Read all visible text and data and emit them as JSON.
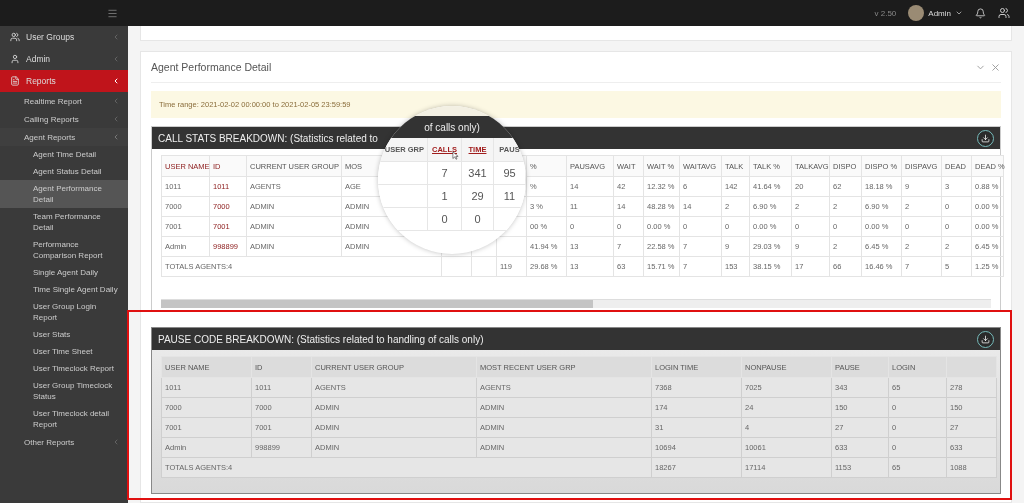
{
  "topbar": {
    "version": "v 2.50",
    "user": "Admin"
  },
  "sidebar": {
    "items": [
      {
        "label": "User Groups",
        "selected": false,
        "expanded": false
      },
      {
        "label": "Admin",
        "selected": false,
        "expanded": false
      },
      {
        "label": "Reports",
        "selected": true,
        "expanded": true,
        "children": [
          {
            "label": "Realtime Report",
            "selected": false,
            "expanded": false
          },
          {
            "label": "Calling Reports",
            "selected": false,
            "expanded": false
          },
          {
            "label": "Agent Reports",
            "selected": false,
            "expanded": true,
            "children": [
              {
                "label": "Agent Time Detail",
                "selected": false
              },
              {
                "label": "Agent Status Detail",
                "selected": false
              },
              {
                "label": "Agent Performance Detail",
                "selected": true
              },
              {
                "label": "Team Performance Detail",
                "selected": false
              },
              {
                "label": "Performance Comparison Report",
                "selected": false
              },
              {
                "label": "Single Agent Daily",
                "selected": false
              },
              {
                "label": "Time Single Agent Daily",
                "selected": false
              },
              {
                "label": "User Group Login Report",
                "selected": false
              },
              {
                "label": "User Stats",
                "selected": false
              },
              {
                "label": "User Time Sheet",
                "selected": false
              },
              {
                "label": "User Timeclock Report",
                "selected": false
              },
              {
                "label": "User Group Timeclock Status",
                "selected": false
              },
              {
                "label": "User Timeclock detail Report",
                "selected": false
              }
            ]
          },
          {
            "label": "Other Reports",
            "selected": false,
            "expanded": false
          }
        ]
      }
    ]
  },
  "panel": {
    "title": "Agent Performance Detail",
    "time_range": "Time range: 2021-02-02 00:00:00 to 2021-02-05 23:59:59"
  },
  "call_stats": {
    "title": "CALL STATS BREAKDOWN: (Statistics related to",
    "columns": [
      {
        "label": "USER NAME",
        "linked": true
      },
      {
        "label": "ID",
        "linked": true
      },
      {
        "label": "CURRENT USER GROUP",
        "linked": false
      },
      {
        "label": "MOS",
        "linked": false
      },
      {},
      {},
      {},
      {
        "label": "%",
        "linked": false
      },
      {
        "label": "PAUSAVG",
        "linked": false
      },
      {
        "label": "WAIT",
        "linked": false
      },
      {
        "label": "WAIT %",
        "linked": false
      },
      {
        "label": "WAITAVG",
        "linked": false
      },
      {
        "label": "TALK",
        "linked": false
      },
      {
        "label": "TALK %",
        "linked": false
      },
      {
        "label": "TALKAVG",
        "linked": false
      },
      {
        "label": "DISPO",
        "linked": false
      },
      {
        "label": "DISPO %",
        "linked": false
      },
      {
        "label": "DISPAVG",
        "linked": false
      },
      {
        "label": "DEAD",
        "linked": false
      },
      {
        "label": "DEAD %",
        "linked": false
      }
    ],
    "rows": [
      [
        "1011",
        "1011",
        "AGENTS",
        "AGE",
        null,
        null,
        null,
        "%",
        "14",
        "42",
        "12.32 %",
        "6",
        "142",
        "41.64 %",
        "20",
        "62",
        "18.18 %",
        "9",
        "3",
        "0.88 %"
      ],
      [
        "7000",
        "7000",
        "ADMIN",
        "ADMIN",
        null,
        null,
        null,
        "3 %",
        "11",
        "14",
        "48.28 %",
        "14",
        "2",
        "6.90 %",
        "2",
        "2",
        "6.90 %",
        "2",
        "0",
        "0.00 %"
      ],
      [
        "7001",
        "7001",
        "ADMIN",
        "ADMIN",
        null,
        null,
        null,
        "00 %",
        "0",
        "0",
        "0.00 %",
        "0",
        "0",
        "0.00 %",
        "0",
        "0",
        "0.00 %",
        "0",
        "0",
        "0.00 %"
      ],
      [
        "Admin",
        "998899",
        "ADMIN",
        "ADMIN",
        null,
        null,
        null,
        "41.94 %",
        "13",
        "7",
        "22.58 %",
        "7",
        "9",
        "29.03 %",
        "9",
        "2",
        "6.45 %",
        "2",
        "2",
        "6.45 %"
      ]
    ],
    "totals": {
      "label": "TOTALS AGENTS:4",
      "cells": [
        null,
        null,
        "119",
        "29.68 %",
        "13",
        "63",
        "15.71 %",
        "7",
        "153",
        "38.15 %",
        "17",
        "66",
        "16.46 %",
        "7",
        "5",
        "1.25 %"
      ]
    }
  },
  "magnifier": {
    "title": "of calls only)",
    "columns": [
      {
        "label": "USER GRP",
        "linked": false
      },
      {
        "label": "CALLS",
        "linked": true
      },
      {
        "label": "TIME",
        "linked": true
      },
      {
        "label": "PAUS",
        "linked": false
      }
    ],
    "rows": [
      [
        null,
        "7",
        "341",
        "95"
      ],
      [
        null,
        "1",
        "29",
        "11"
      ],
      [
        null,
        "0",
        "0",
        null
      ]
    ]
  },
  "pause_code": {
    "title": "PAUSE CODE BREAKDOWN: (Statistics related to handling of calls only)",
    "columns": [
      "USER NAME",
      "ID",
      "CURRENT USER GROUP",
      "MOST RECENT USER GRP",
      "LOGIN TIME",
      "NONPAUSE",
      "PAUSE",
      "LOGIN",
      null
    ],
    "rows": [
      [
        "1011",
        "1011",
        "AGENTS",
        "AGENTS",
        "7368",
        "7025",
        "343",
        "65",
        "278"
      ],
      [
        "7000",
        "7000",
        "ADMIN",
        "ADMIN",
        "174",
        "24",
        "150",
        "0",
        "150"
      ],
      [
        "7001",
        "7001",
        "ADMIN",
        "ADMIN",
        "31",
        "4",
        "27",
        "0",
        "27"
      ],
      [
        "Admin",
        "998899",
        "ADMIN",
        "ADMIN",
        "10694",
        "10061",
        "633",
        "0",
        "633"
      ]
    ],
    "totals": {
      "label": "TOTALS AGENTS:4",
      "cells": [
        "18267",
        "17114",
        "1153",
        "65",
        "1088"
      ]
    }
  }
}
